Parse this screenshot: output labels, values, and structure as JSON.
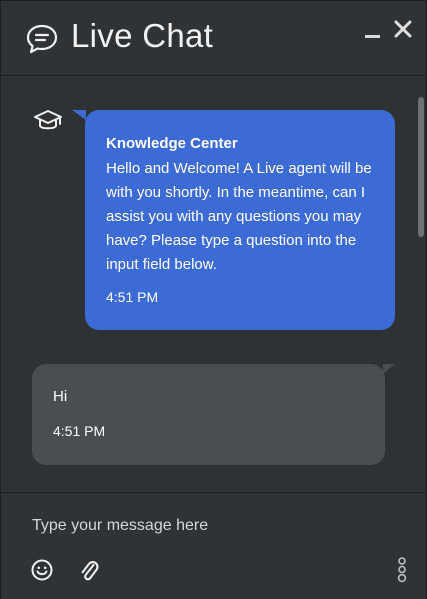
{
  "header": {
    "title": "Live Chat",
    "icons": {
      "chat": "chat-bubble-icon",
      "minimize": "minimize-icon",
      "close": "close-icon"
    }
  },
  "messages": [
    {
      "from": "bot",
      "avatar_icon": "graduation-cap-icon",
      "sender": "Knowledge Center",
      "text": "Hello and Welcome! A Live agent will be with you shortly. In the meantime, can I assist you with any questions you may have? Please type a question into the input field below.",
      "time": "4:51 PM"
    },
    {
      "from": "user",
      "text": "Hi",
      "time": "4:51 PM"
    }
  ],
  "composer": {
    "placeholder": "Type your message here",
    "value": "",
    "icons": {
      "emoji": "smiley-icon",
      "attach": "paperclip-icon",
      "brand": "brand-logo-icon"
    }
  },
  "colors": {
    "background": "#303336",
    "bot_bubble": "#3d6bd6",
    "user_bubble": "#4a4d52",
    "text": "#ffffff"
  }
}
